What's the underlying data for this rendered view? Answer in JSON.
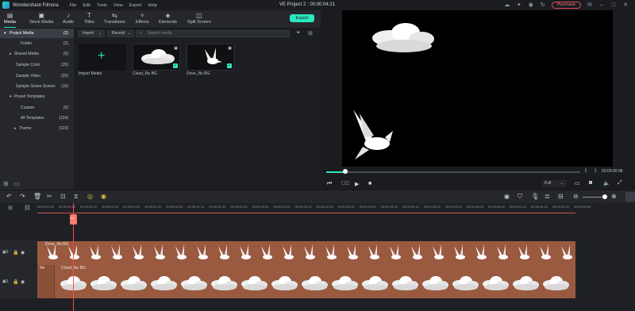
{
  "app": {
    "name": "Wondershare Filmora",
    "menu": [
      "File",
      "Edit",
      "Tools",
      "View",
      "Export",
      "Help"
    ],
    "project_title": "VE Project 2 : 00:00:04:21",
    "purchase_label": "Purchase"
  },
  "toolbar": {
    "tabs": [
      {
        "label": "Media",
        "icon": "media-icon"
      },
      {
        "label": "Stock Media",
        "icon": "stock-media-icon"
      },
      {
        "label": "Audio",
        "icon": "audio-icon"
      },
      {
        "label": "Titles",
        "icon": "titles-icon"
      },
      {
        "label": "Transitions",
        "icon": "transitions-icon"
      },
      {
        "label": "Effects",
        "icon": "effects-icon"
      },
      {
        "label": "Elements",
        "icon": "elements-icon"
      },
      {
        "label": "Split Screen",
        "icon": "split-screen-icon"
      }
    ],
    "export_label": "Export"
  },
  "sidebar": {
    "items": [
      {
        "label": "Project Media",
        "count": "(2)"
      },
      {
        "label": "Folder",
        "count": "(2)"
      },
      {
        "label": "Shared Media",
        "count": "(0)"
      },
      {
        "label": "Sample Color",
        "count": "(25)"
      },
      {
        "label": "Sample Video",
        "count": "(20)"
      },
      {
        "label": "Sample Green Screen",
        "count": "(10)"
      },
      {
        "label": "Preset Templates",
        "count": ""
      },
      {
        "label": "Custom",
        "count": "(0)"
      },
      {
        "label": "All Templates",
        "count": "(124)"
      },
      {
        "label": "Theme",
        "count": "(123)"
      }
    ]
  },
  "media": {
    "import_label": "Import",
    "record_label": "Record",
    "search_placeholder": "Search media",
    "items": [
      {
        "label": "Import Media"
      },
      {
        "label": "Cloud_No BG"
      },
      {
        "label": "Dove_No BG"
      }
    ]
  },
  "preview": {
    "timecode": "00:00:00:08",
    "quality": "Full"
  },
  "ruler": {
    "ticks": [
      "00:00:00:00",
      "00:00:00:05",
      "00:00:00:10",
      "00:00:00:15",
      "00:00:00:20",
      "00:00:01:00",
      "00:00:01:05",
      "00:00:01:10",
      "00:00:01:15",
      "00:00:01:20",
      "00:00:02:00",
      "00:00:02:05",
      "00:00:02:10",
      "00:00:02:15",
      "00:00:02:20",
      "00:00:03:00",
      "00:00:03:05",
      "00:00:03:10",
      "00:00:03:15",
      "00:00:03:20",
      "00:00:04:00",
      "00:00:04:05",
      "00:00:04:10",
      "00:00:04:15",
      "00:00:04:20",
      "00:00:05:00"
    ]
  },
  "tracks": {
    "track2_label": "Dove_No BG",
    "track1_label": "Cloud_No BG",
    "track1_small": "No"
  },
  "colors": {
    "accent": "#2ee6c0",
    "clip": "#9a5a3f",
    "playhead": "#ff4a4a"
  }
}
